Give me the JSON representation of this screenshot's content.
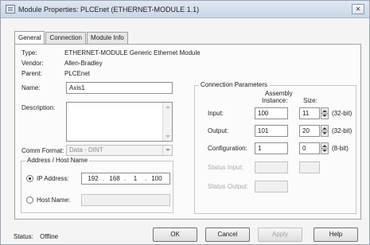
{
  "window": {
    "title": "Module Properties: PLCEnet (ETHERNET-MODULE 1.1)",
    "close_glyph": "✕"
  },
  "tabs": [
    {
      "label": "General",
      "active": true
    },
    {
      "label": "Connection",
      "active": false
    },
    {
      "label": "Module Info",
      "active": false
    }
  ],
  "general": {
    "type_label": "Type:",
    "type_value": "ETHERNET-MODULE Generic Ethernet Module",
    "vendor_label": "Vendor:",
    "vendor_value": "Allen-Bradley",
    "parent_label": "Parent:",
    "parent_value": "PLCEnet",
    "name_label": "Name:",
    "name_value": "Axis1",
    "description_label": "Description:",
    "description_value": "",
    "comm_format_label": "Comm Format:",
    "comm_format_value": "Data - DINT"
  },
  "address": {
    "group_title": "Address / Host Name",
    "ip_label": "IP Address:",
    "ip_octets": [
      "192",
      "168",
      "1",
      "100"
    ],
    "ip_selected": true,
    "host_label": "Host Name:",
    "host_value": ""
  },
  "connection": {
    "group_title": "Connection Parameters",
    "assembly_header_line1": "Assembly",
    "assembly_header_line2": "Instance:",
    "size_header": "Size:",
    "rows": [
      {
        "label": "Input:",
        "instance": "100",
        "size": "11",
        "unit": "(32-bit)",
        "enabled": true
      },
      {
        "label": "Output:",
        "instance": "101",
        "size": "20",
        "unit": "(32-bit)",
        "enabled": true
      },
      {
        "label": "Configuration:",
        "instance": "1",
        "size": "0",
        "unit": "(8-bit)",
        "enabled": true
      },
      {
        "label": "Status Input:",
        "instance": "",
        "size": "",
        "unit": "",
        "enabled": false
      },
      {
        "label": "Status Output:",
        "instance": "",
        "size": "",
        "unit": "",
        "enabled": false
      }
    ]
  },
  "status": {
    "label": "Status:",
    "value": "Offline"
  },
  "buttons": {
    "ok": "OK",
    "cancel": "Cancel",
    "apply": "Apply",
    "help": "Help"
  }
}
